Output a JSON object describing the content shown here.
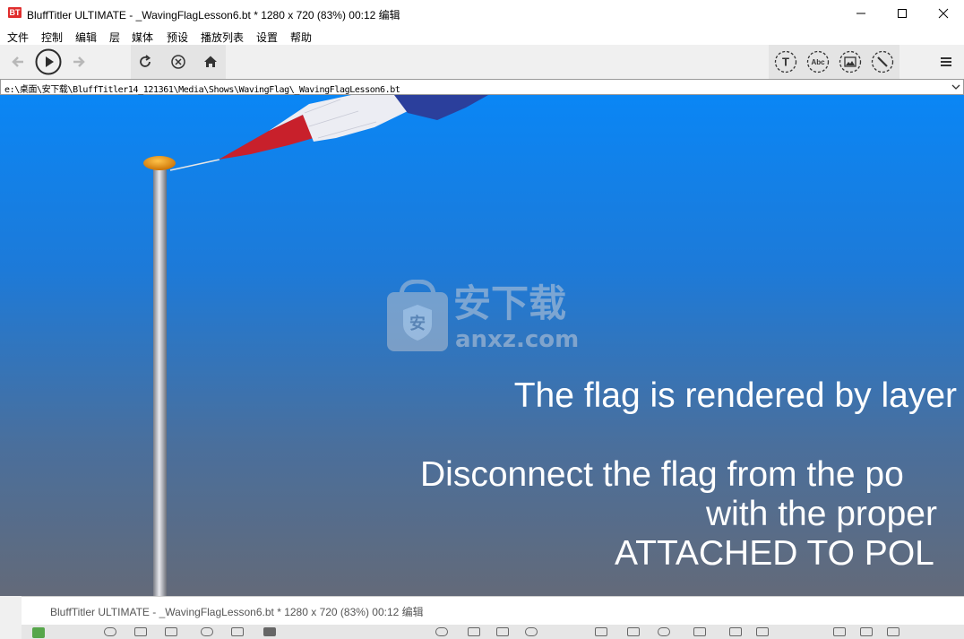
{
  "window": {
    "app_icon": "BT",
    "title": "BluffTitler ULTIMATE  - _WavingFlagLesson6.bt * 1280 x 720 (83%) 00:12 编辑",
    "controls": [
      "minimize-icon",
      "maximize-icon",
      "close-icon"
    ]
  },
  "menu": {
    "items": [
      "文件",
      "控制",
      "编辑",
      "层",
      "媒体",
      "预设",
      "播放列表",
      "设置",
      "帮助"
    ]
  },
  "toolbar": {
    "left": [
      "back-icon",
      "play-icon",
      "forward-icon"
    ],
    "middle": [
      "refresh-icon",
      "stop-icon",
      "home-icon"
    ],
    "right": [
      "text-layer-icon",
      "abc-layer-icon",
      "picture-layer-icon",
      "effect-layer-icon",
      "menu-icon"
    ],
    "right_labels": [
      "T",
      "Abc"
    ]
  },
  "path": {
    "value": "e:\\桌面\\安下载\\BluffTitler14_121361\\Media\\Shows\\WavingFlag\\_WavingFlagLesson6.bt"
  },
  "viewport": {
    "line1": "The flag is rendered by layer",
    "line2": "Disconnect the flag from the po",
    "line3": "with the proper",
    "line4": "ATTACHED TO POL",
    "watermark_cn": "安下载",
    "watermark_en": "anxz.com",
    "watermark_badge": "安"
  },
  "second_window": {
    "title": "BluffTitler ULTIMATE  - _WavingFlagLesson6.bt * 1280 x 720 (83%) 00:12 编辑"
  }
}
